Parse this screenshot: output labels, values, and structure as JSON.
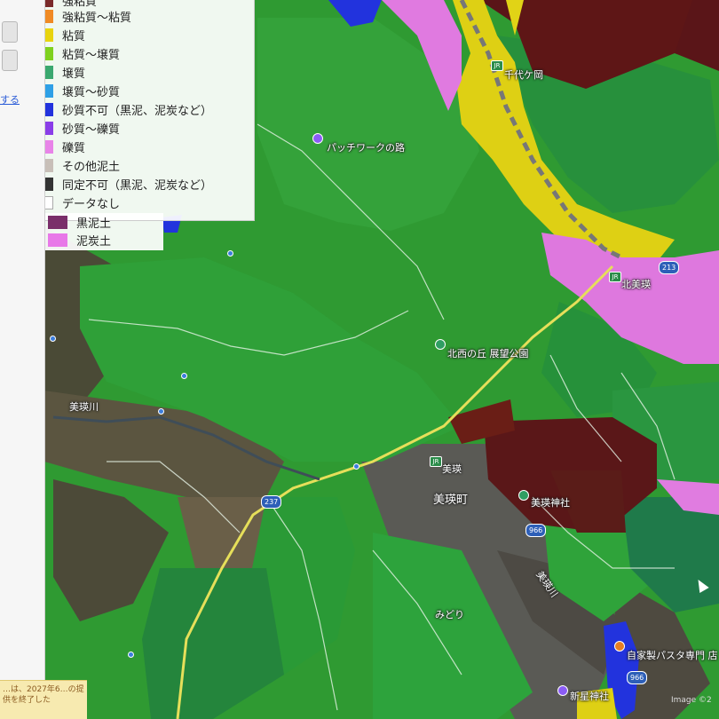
{
  "legend": {
    "items": [
      {
        "label": "強粘質",
        "color": "#7a2a2a"
      },
      {
        "label": "強粘質～粘質",
        "color": "#f08a24"
      },
      {
        "label": "粘質",
        "color": "#e8d40e"
      },
      {
        "label": "粘質～壌質",
        "color": "#7fd11e"
      },
      {
        "label": "壌質",
        "color": "#3aa86f"
      },
      {
        "label": "壌質～砂質",
        "color": "#2ea0e6"
      },
      {
        "label": "砂質不可（黒泥、泥炭など）",
        "color": "#2233dd"
      },
      {
        "label": "砂質～礫質",
        "color": "#8a3ee8"
      },
      {
        "label": "礫質",
        "color": "#e884e8"
      },
      {
        "label": "その他泥土",
        "color": "#c8bfb8"
      },
      {
        "label": "同定不可（黒泥、泥炭など）",
        "color": "#333333"
      },
      {
        "label": "データなし",
        "color": "#ffffff"
      },
      {
        "label": "黒泥土",
        "color": "#7a2f6a"
      },
      {
        "label": "泥炭土",
        "color": "#e878e8"
      }
    ]
  },
  "side": {
    "link_text": "する",
    "note_text": "…は、2027年6…の提供を終了した"
  },
  "map": {
    "labels": {
      "chiyogaoka": "千代ケ岡",
      "patchwork": "パッチワークの路",
      "kitanishi": "北西の丘 展望公園",
      "kitabiei": "北美瑛",
      "biei_river": "美瑛川",
      "biei_station": "美瑛",
      "biei_town": "美瑛町",
      "biei_shrine": "美瑛神社",
      "biei_river2": "美瑛川",
      "midori": "みどり",
      "pasta": "自家製パスタ専門 店",
      "shrine2": "新星神社"
    },
    "roads": {
      "r213": "213",
      "r237": "237",
      "r966a": "966",
      "r966b": "966"
    },
    "station_icon": "JR",
    "copyright": "Image ©2"
  },
  "icons": {
    "poi": "map-pin-icon",
    "station": "train-station-icon",
    "cursor": "mouse-cursor-icon"
  }
}
